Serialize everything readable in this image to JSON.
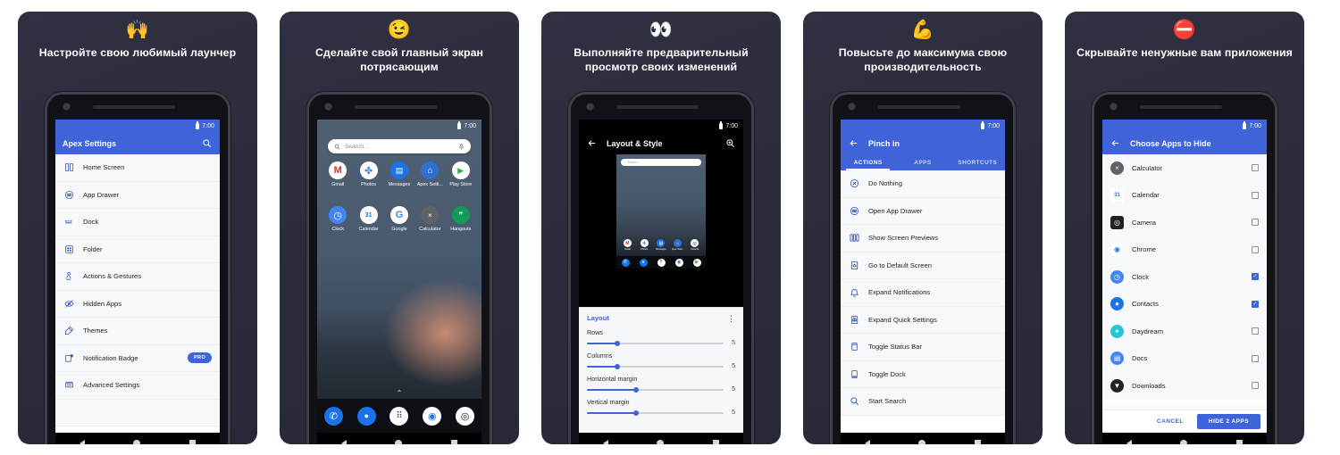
{
  "page": {
    "background": "#ffffff",
    "panel_background": "#2b2d3c",
    "accent": "#3f63d8",
    "status_time": "7:00"
  },
  "panels": [
    {
      "emoji": "🙌",
      "emoji_name": "raising-hands-emoji",
      "headline": "Настройте свою любимый лаунчер",
      "screen": {
        "type": "settings-list",
        "appbar_title": "Apex Settings",
        "appbar_has_back": false,
        "appbar_action_icon": "search-icon",
        "status_time": "7:00",
        "items": [
          {
            "label": "Home Screen",
            "icon": "home-screen-icon"
          },
          {
            "label": "App Drawer",
            "icon": "app-drawer-icon"
          },
          {
            "label": "Dock",
            "icon": "dock-icon"
          },
          {
            "label": "Folder",
            "icon": "folder-icon"
          },
          {
            "label": "Actions & Gestures",
            "icon": "gestures-icon"
          },
          {
            "label": "Hidden Apps",
            "icon": "hidden-apps-icon"
          },
          {
            "label": "Themes",
            "icon": "themes-icon"
          },
          {
            "label": "Notification Badge",
            "icon": "notification-badge-icon",
            "badge": "PRO"
          },
          {
            "label": "Advanced Settings",
            "icon": "advanced-settings-icon"
          }
        ]
      }
    },
    {
      "emoji": "😉",
      "emoji_name": "winking-face-emoji",
      "headline": "Сделайте свой главный экран потрясающим",
      "screen": {
        "type": "home-screen",
        "status_time": "7:00",
        "search_placeholder": "Search...",
        "search_icon": "search-icon",
        "mic_icon": "microphone-icon",
        "row1": [
          {
            "name": "Gmail",
            "glyph": "M",
            "color": "#d93025",
            "bg": "#ffffff"
          },
          {
            "name": "Photos",
            "glyph": "✤",
            "color": "#4285f4",
            "bg": "#ffffff"
          },
          {
            "name": "Messages",
            "glyph": "▤",
            "color": "#ffffff",
            "bg": "#1a73e8"
          },
          {
            "name": "Apex Setti...",
            "glyph": "⌂",
            "color": "#ffffff",
            "bg": "#2f6fd0"
          },
          {
            "name": "Play Store",
            "glyph": "▶",
            "color": "#34a853",
            "bg": "#ffffff"
          }
        ],
        "row2": [
          {
            "name": "Clock",
            "glyph": "◷",
            "color": "#ffffff",
            "bg": "#4285f4"
          },
          {
            "name": "Calendar",
            "glyph": "31",
            "color": "#1a73e8",
            "bg": "#ffffff"
          },
          {
            "name": "Google",
            "glyph": "G",
            "color": "#4285f4",
            "bg": "#ffffff"
          },
          {
            "name": "Calculator",
            "glyph": "×",
            "color": "#ffffff",
            "bg": "#5f6368"
          },
          {
            "name": "Hangouts",
            "glyph": "❞",
            "color": "#ffffff",
            "bg": "#0f9d58"
          }
        ],
        "dock": [
          {
            "name": "Phone",
            "glyph": "✆",
            "color": "#ffffff",
            "bg": "#1a73e8"
          },
          {
            "name": "Contacts",
            "glyph": "●",
            "color": "#ffffff",
            "bg": "#1a73e8"
          },
          {
            "name": "All Apps",
            "glyph": "⠿",
            "color": "#ffffff",
            "bg": "#ffffff"
          },
          {
            "name": "Chrome",
            "glyph": "◉",
            "color": "#1a73e8",
            "bg": "#ffffff"
          },
          {
            "name": "Camera",
            "glyph": "◎",
            "color": "#111111",
            "bg": "#ffffff"
          }
        ]
      }
    },
    {
      "emoji": "👀",
      "emoji_name": "eyes-emoji",
      "headline": "Выполняйте предварительный просмотр своих изменений",
      "screen": {
        "type": "layout-preview",
        "status_time": "7:00",
        "appbar_title": "Layout & Style",
        "appbar_has_back": true,
        "appbar_action_icon": "zoom-in-icon",
        "preview_search_placeholder": "Search...",
        "sheet_title": "Layout",
        "sheet_menu_icon": "overflow-menu-icon",
        "sliders": [
          {
            "label": "Rows",
            "value": "5",
            "percent": 22
          },
          {
            "label": "Columns",
            "value": "5",
            "percent": 22
          },
          {
            "label": "Horizontal margin",
            "value": "5",
            "percent": 36
          },
          {
            "label": "Vertical margin",
            "value": "5",
            "percent": 36
          }
        ],
        "preview_apps": [
          "Gmail",
          "Photos",
          "Messages",
          "Apex Setti...",
          "Camera"
        ]
      }
    },
    {
      "emoji": "💪",
      "emoji_name": "flexed-biceps-emoji",
      "headline": "Повысьте до максимума свою производительность",
      "screen": {
        "type": "actions-list",
        "status_time": "7:00",
        "appbar_title": "Pinch in",
        "appbar_has_back": true,
        "tabs": [
          {
            "label": "ACTIONS",
            "active": true
          },
          {
            "label": "APPS",
            "active": false
          },
          {
            "label": "SHORTCUTS",
            "active": false
          }
        ],
        "items": [
          {
            "label": "Do Nothing",
            "icon": "do-nothing-icon"
          },
          {
            "label": "Open App Drawer",
            "icon": "app-drawer-icon"
          },
          {
            "label": "Show Screen Previews",
            "icon": "screen-previews-icon"
          },
          {
            "label": "Go to Default Screen",
            "icon": "default-screen-icon"
          },
          {
            "label": "Expand Notifications",
            "icon": "bell-icon"
          },
          {
            "label": "Expand Quick Settings",
            "icon": "quick-settings-icon"
          },
          {
            "label": "Toggle Status Bar",
            "icon": "status-bar-icon"
          },
          {
            "label": "Toggle Dock",
            "icon": "dock-icon"
          },
          {
            "label": "Start Search",
            "icon": "search-icon"
          }
        ]
      }
    },
    {
      "emoji": "⛔",
      "emoji_name": "no-entry-emoji",
      "headline": "Скрывайте ненужные вам приложения",
      "screen": {
        "type": "hide-apps-list",
        "status_time": "7:00",
        "appbar_title": "Choose Apps to Hide",
        "appbar_has_back": true,
        "apps": [
          {
            "name": "Calculator",
            "checked": false,
            "glyph": "×",
            "color": "#ffffff",
            "bg": "#5f6368"
          },
          {
            "name": "Calendar",
            "checked": false,
            "glyph": "31",
            "color": "#1a73e8",
            "bg": "#ffffff"
          },
          {
            "name": "Camera",
            "checked": false,
            "glyph": "◎",
            "color": "#ffffff",
            "bg": "#202124"
          },
          {
            "name": "Chrome",
            "checked": false,
            "glyph": "◉",
            "color": "#1a73e8",
            "bg": "#ffffff"
          },
          {
            "name": "Clock",
            "checked": true,
            "glyph": "◷",
            "color": "#ffffff",
            "bg": "#4285f4"
          },
          {
            "name": "Contacts",
            "checked": true,
            "glyph": "●",
            "color": "#ffffff",
            "bg": "#1a73e8"
          },
          {
            "name": "Daydream",
            "checked": false,
            "glyph": "✦",
            "color": "#ffffff",
            "bg": "#26c6da"
          },
          {
            "name": "Docs",
            "checked": false,
            "glyph": "▤",
            "color": "#ffffff",
            "bg": "#4285f4"
          },
          {
            "name": "Downloads",
            "checked": false,
            "glyph": "▼",
            "color": "#ffffff",
            "bg": "#202124"
          }
        ],
        "cancel_label": "CANCEL",
        "confirm_label": "HIDE 2 APPS"
      }
    }
  ]
}
